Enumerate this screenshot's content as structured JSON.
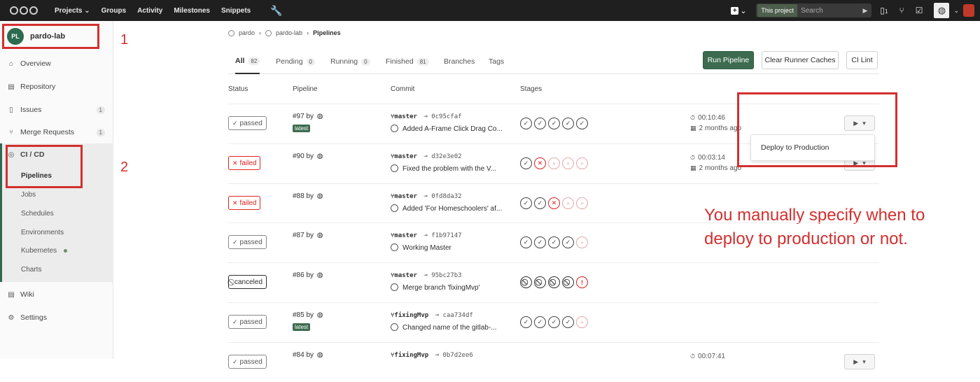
{
  "topnav": {
    "items": [
      "Projects ⌄",
      "Groups",
      "Activity",
      "Milestones",
      "Snippets"
    ],
    "search_scope": "This project",
    "search_placeholder": "Search",
    "issues_count": "1"
  },
  "sidebar": {
    "project_name": "pardo-lab",
    "project_initials": "PL",
    "items": [
      {
        "label": "Overview",
        "icon": "home-icon"
      },
      {
        "label": "Repository",
        "icon": "book-icon"
      },
      {
        "label": "Issues",
        "icon": "issues-icon",
        "count": "1"
      },
      {
        "label": "Merge Requests",
        "icon": "merge-icon",
        "count": "1"
      },
      {
        "label": "CI / CD",
        "icon": "rocket-icon"
      },
      {
        "label": "Wiki",
        "icon": "book-icon"
      },
      {
        "label": "Settings",
        "icon": "gear-icon"
      }
    ],
    "cicd_sub": [
      "Pipelines",
      "Jobs",
      "Schedules",
      "Environments",
      "Kubernetes",
      "Charts"
    ]
  },
  "annotations": {
    "num1": "1",
    "num2": "2",
    "note": "You manually specify when to deploy to production or not."
  },
  "breadcrumb": [
    "pardo",
    "pardo-lab",
    "Pipelines"
  ],
  "tabs": [
    {
      "label": "All",
      "count": "82"
    },
    {
      "label": "Pending",
      "count": "0"
    },
    {
      "label": "Running",
      "count": "0"
    },
    {
      "label": "Finished",
      "count": "81"
    },
    {
      "label": "Branches",
      "count": ""
    },
    {
      "label": "Tags",
      "count": ""
    }
  ],
  "buttons": {
    "run": "Run Pipeline",
    "clear": "Clear Runner Caches",
    "lint": "CI Lint"
  },
  "headers": {
    "status": "Status",
    "pipeline": "Pipeline",
    "commit": "Commit",
    "stages": "Stages"
  },
  "dropdown": {
    "item": "Deploy to Production"
  },
  "pipelines": [
    {
      "status": "passed",
      "id": "#97 by",
      "latest": "latest",
      "branch": "master",
      "sha": "0c95cfaf",
      "message": "Added A-Frame Click Drag Co...",
      "stages": [
        "ok",
        "ok",
        "ok",
        "ok",
        "ok"
      ],
      "duration": "00:10:46",
      "ago": "2 months ago"
    },
    {
      "status": "failed",
      "id": "#90 by",
      "latest": "",
      "branch": "master",
      "sha": "d32e3e02",
      "message": "Fixed the problem with the V...",
      "stages": [
        "ok",
        "fail",
        "skip",
        "skip",
        "skip"
      ],
      "duration": "00:03:14",
      "ago": "2 months ago"
    },
    {
      "status": "failed",
      "id": "#88 by",
      "latest": "",
      "branch": "master",
      "sha": "0fd8da32",
      "message": "Added 'For Homeschoolers' af...",
      "stages": [
        "ok",
        "ok",
        "fail",
        "skip",
        "skip"
      ],
      "duration": "",
      "ago": ""
    },
    {
      "status": "passed",
      "id": "#87 by",
      "latest": "",
      "branch": "master",
      "sha": "f1b97147",
      "message": "Working Master",
      "stages": [
        "ok",
        "ok",
        "ok",
        "ok",
        "skip"
      ],
      "duration": "",
      "ago": ""
    },
    {
      "status": "canceled",
      "id": "#86 by",
      "latest": "",
      "branch": "master",
      "sha": "95bc27b3",
      "message": "Merge branch 'fixingMvp'",
      "stages": [
        "cancel",
        "cancel",
        "cancel",
        "cancel",
        "warn"
      ],
      "duration": "",
      "ago": ""
    },
    {
      "status": "passed",
      "id": "#85 by",
      "latest": "latest",
      "branch": "fixingMvp",
      "sha": "caa734df",
      "message": "Changed name of the gitlab-...",
      "stages": [
        "ok",
        "ok",
        "ok",
        "ok",
        "skip"
      ],
      "duration": "",
      "ago": ""
    },
    {
      "status": "passed",
      "id": "#84 by",
      "latest": "",
      "branch": "fixingMvp",
      "sha": "0b7d2ee6",
      "message": "",
      "stages": [],
      "duration": "00:07:41",
      "ago": ""
    }
  ]
}
